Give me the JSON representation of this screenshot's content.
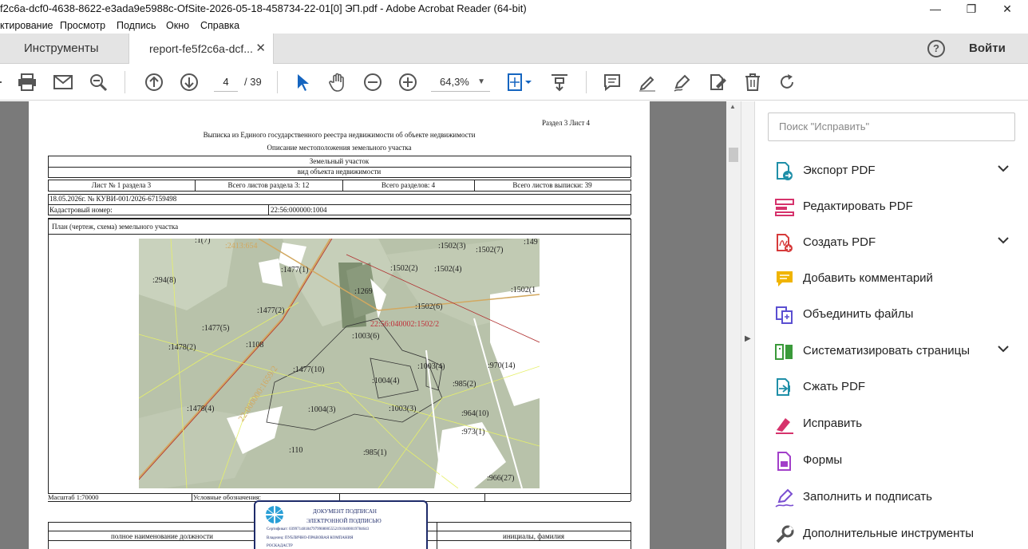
{
  "window": {
    "title": "f2c6a-dcf0-4638-8622-e3ada9e5988c-OfSite-2026-05-18-458734-22-01[0] ЭП.pdf - Adobe Acrobat Reader (64-bit)",
    "minimize": "—",
    "maximize": "❐",
    "close": "✕"
  },
  "menu": [
    "ктирование",
    "Просмотр",
    "Подпись",
    "Окно",
    "Справка"
  ],
  "tabs": {
    "tools": "Инструменты",
    "doc": "report-fe5f2c6a-dcf...",
    "doc_close": "✕"
  },
  "header": {
    "help": "?",
    "login": "Войти"
  },
  "toolbar": {
    "page_current": "4",
    "page_total": "/ 39",
    "zoom": "64,3%",
    "zoom_caret": "▼"
  },
  "document": {
    "section_sheet": "Раздел 3    Лист 4",
    "title1": "Выписка из Единого государственного реестра недвижимости об объекте недвижимости",
    "title2": "Описание местоположения земельного участка",
    "object_type": "Земельный участок",
    "object_type_label": "вид объекта недвижимости",
    "row_sheets": [
      "Лист № 1 раздела 3",
      "Всего листов раздела 3: 12",
      "Всего разделов: 4",
      "Всего листов выписки: 39"
    ],
    "date_number": "18.05.2026г. № КУВИ-001/2026-67159498",
    "cadastral_label": "Кадастровый номер:",
    "cadastral_value": "22:56:000000:1004",
    "plan_title": "План (чертеж, схема) земельного участка",
    "scale": "Масштаб 1:70000",
    "legend": "Условные обозначения:",
    "footer_position": "полное наименование должности",
    "footer_name": "инициалы, фамилия",
    "map_labels": [
      ":1(7)",
      ":1502(3)",
      ":1502(7)",
      ":149",
      ":1477(1)",
      ":1502(2)",
      ":1502(4)",
      ":294(8)",
      ":1269",
      ":1502(1",
      ":1477(2)",
      ":1502(6)",
      "22:56:040002:1502/2",
      ":1477(5)",
      ":1003(6)",
      ":1478(2)",
      ":1108",
      ":1003(4)",
      ":970(14)",
      ":1477(10)",
      ":1004(4)",
      ":985(2)",
      ":1478(4)",
      ":1004(3)",
      ":1003(3)",
      ":964(10)",
      ":973(1)",
      ":110",
      ":985(1)",
      ":966(27)",
      "22:000000:1659/2",
      ":2413:654"
    ]
  },
  "stamp": {
    "line1": "ДОКУМЕНТ ПОДПИСАН",
    "line2": "ЭЛЕКТРОННОЙ ПОДПИСЬЮ",
    "line3": "Сертификат: 0399714818479799080055521910400019784643",
    "line4": "Владелец: ПУБЛИЧНО-ПРАВОВАЯ КОМПАНИЯ",
    "line5": "РОСКАДАСТР"
  },
  "right_pane": {
    "search_placeholder": "Поиск \"Исправить\"",
    "tools": [
      {
        "label": "Экспорт PDF",
        "icon": "export-pdf-icon",
        "color": "#1f8fa8",
        "chevron": true
      },
      {
        "label": "Редактировать PDF",
        "icon": "edit-pdf-icon",
        "color": "#d6336c",
        "chevron": false
      },
      {
        "label": "Создать PDF",
        "icon": "create-pdf-icon",
        "color": "#d63a3a",
        "chevron": true
      },
      {
        "label": "Добавить комментарий",
        "icon": "comment-icon",
        "color": "#f0b400",
        "chevron": false
      },
      {
        "label": "Объединить файлы",
        "icon": "combine-files-icon",
        "color": "#5b4fd1",
        "chevron": false
      },
      {
        "label": "Систематизировать страницы",
        "icon": "organize-pages-icon",
        "color": "#3a9a3a",
        "chevron": true
      },
      {
        "label": "Сжать PDF",
        "icon": "compress-pdf-icon",
        "color": "#1f8fa8",
        "chevron": false
      },
      {
        "label": "Исправить",
        "icon": "redact-icon",
        "color": "#d6336c",
        "chevron": false
      },
      {
        "label": "Формы",
        "icon": "forms-icon",
        "color": "#a23fc9",
        "chevron": false
      },
      {
        "label": "Заполнить и подписать",
        "icon": "fill-sign-icon",
        "color": "#7a4ed1",
        "chevron": false
      },
      {
        "label": "Дополнительные инструменты",
        "icon": "more-tools-icon",
        "color": "#555555",
        "chevron": false
      }
    ]
  }
}
